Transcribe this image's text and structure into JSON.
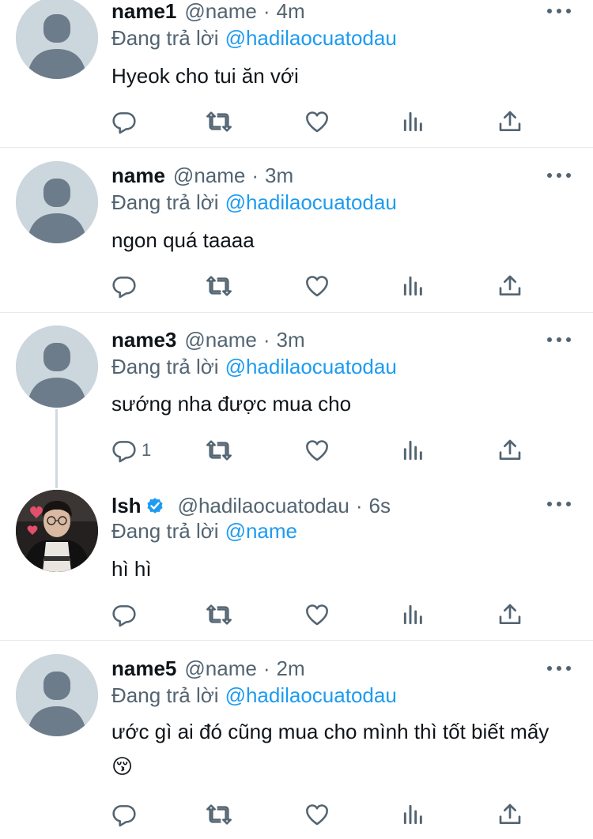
{
  "tweets": [
    {
      "name": "name1",
      "handle": "@name",
      "time": "4m",
      "replying_label": "Đang trả lời",
      "replying_to": "@hadilaocuatodau",
      "text": "Hyeok cho tui ăn với",
      "reply_count": ""
    },
    {
      "name": "name",
      "handle": "@name",
      "time": "3m",
      "replying_label": "Đang trả lời",
      "replying_to": "@hadilaocuatodau",
      "text": "ngon quá taaaa",
      "reply_count": ""
    },
    {
      "name": "name3",
      "handle": "@name",
      "time": "3m",
      "replying_label": "Đang trả lời",
      "replying_to": "@hadilaocuatodau",
      "text": "sướng nha được mua cho",
      "reply_count": "1"
    },
    {
      "name": "lsh",
      "handle": "@hadilaocuatodau",
      "time": "6s",
      "verified": true,
      "replying_label": "Đang trả lời",
      "replying_to": "@name",
      "text": "hì hì",
      "reply_count": ""
    },
    {
      "name": "name5",
      "handle": "@name",
      "time": "2m",
      "replying_label": "Đang trả lời",
      "replying_to": "@hadilaocuatodau",
      "text": "ước gì ai đó cũng mua cho mình thì tốt biết mấy 😚",
      "reply_count": ""
    }
  ],
  "separator": "·",
  "icons": {
    "reply": "reply-icon",
    "retweet": "retweet-icon",
    "like": "like-icon",
    "views": "views-icon",
    "share": "share-icon",
    "more": "more-icon",
    "verified": "verified-icon"
  },
  "colors": {
    "link": "#1d9bf0",
    "secondary_text": "#536471",
    "primary_text": "#0f1419",
    "divider": "#e6e9ec",
    "avatar_placeholder": "#ccd6dd",
    "avatar_silhouette": "#6d7c8b"
  }
}
